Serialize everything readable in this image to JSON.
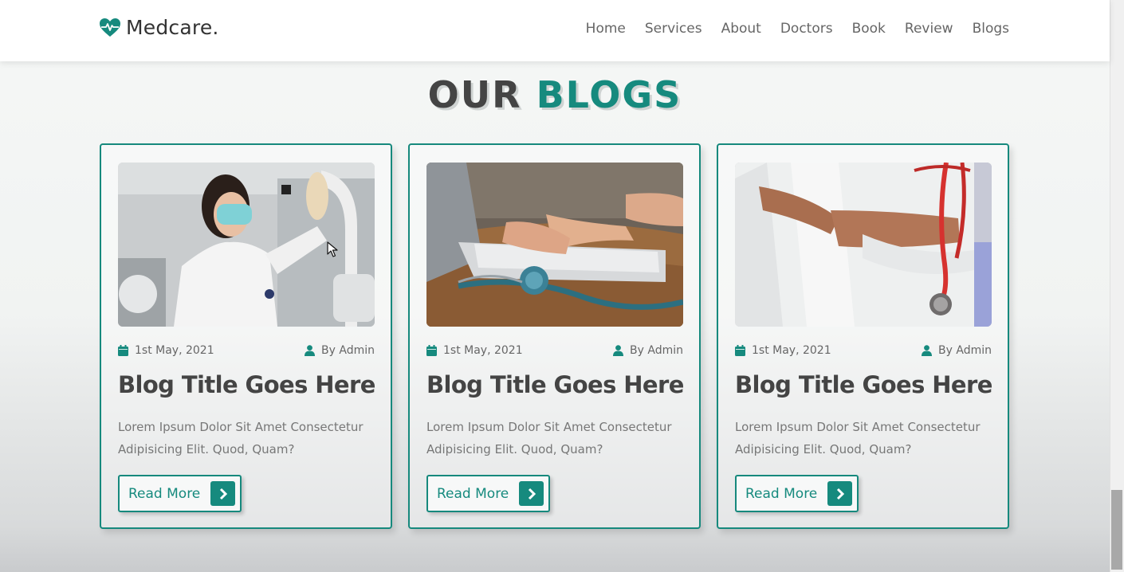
{
  "brand": {
    "name": "Medcare.",
    "color": "#168a7e"
  },
  "nav": {
    "items": [
      {
        "label": "Home"
      },
      {
        "label": "Services"
      },
      {
        "label": "About"
      },
      {
        "label": "Doctors"
      },
      {
        "label": "Book"
      },
      {
        "label": "Review"
      },
      {
        "label": "Blogs"
      }
    ]
  },
  "section": {
    "heading_part1": "OUR",
    "heading_part2": "BLOGS"
  },
  "blogs": [
    {
      "image": "doctor-with-mask-lab-photo",
      "date": "1st May, 2021",
      "author": "By Admin",
      "title": "Blog Title Goes Here",
      "text_line1": "Lorem Ipsum Dolor Sit Amet Consectetur",
      "text_line2": "Adipisicing Elit. Quod, Quam?",
      "button": "Read More"
    },
    {
      "image": "laptop-stethoscope-photo",
      "date": "1st May, 2021",
      "author": "By Admin",
      "title": "Blog Title Goes Here",
      "text_line1": "Lorem Ipsum Dolor Sit Amet Consectetur",
      "text_line2": "Adipisicing Elit. Quod, Quam?",
      "button": "Read More"
    },
    {
      "image": "doctor-holding-stethoscope-photo",
      "date": "1st May, 2021",
      "author": "By Admin",
      "title": "Blog Title Goes Here",
      "text_line1": "Lorem Ipsum Dolor Sit Amet Consectetur",
      "text_line2": "Adipisicing Elit. Quod, Quam?",
      "button": "Read More"
    }
  ],
  "icons": {
    "logo": "heartbeat-icon",
    "date": "calendar-icon",
    "author": "user-icon",
    "button": "chevron-right-icon"
  }
}
